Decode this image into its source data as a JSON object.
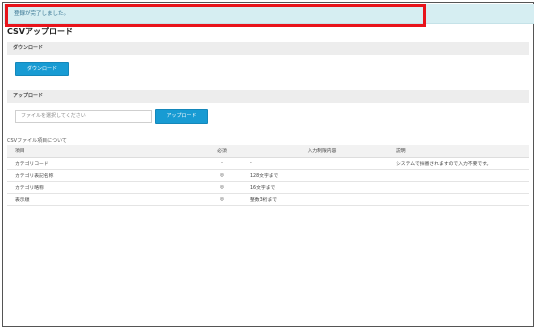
{
  "alert": {
    "message": "登録が完了しました。"
  },
  "page": {
    "title": "CSVアップロード"
  },
  "download_section": {
    "heading": "ダウンロード",
    "button_label": "ダウンロード"
  },
  "upload_section": {
    "heading": "アップロード",
    "file_placeholder": "ファイルを選択してください",
    "button_label": "アップロード"
  },
  "csv_table": {
    "caption": "CSVファイル項目について",
    "headers": [
      "項目",
      "必須",
      "入力制限内容",
      "説明"
    ],
    "rows": [
      [
        "カテゴリコード",
        "-",
        "-",
        "システムで採番されますので入力不要です。"
      ],
      [
        "カテゴリ表記名称",
        "◎",
        "128文字まで",
        ""
      ],
      [
        "カテゴリ略称",
        "◎",
        "16文字まで",
        ""
      ],
      [
        "表示順",
        "◎",
        "整数3桁まで",
        ""
      ]
    ]
  }
}
